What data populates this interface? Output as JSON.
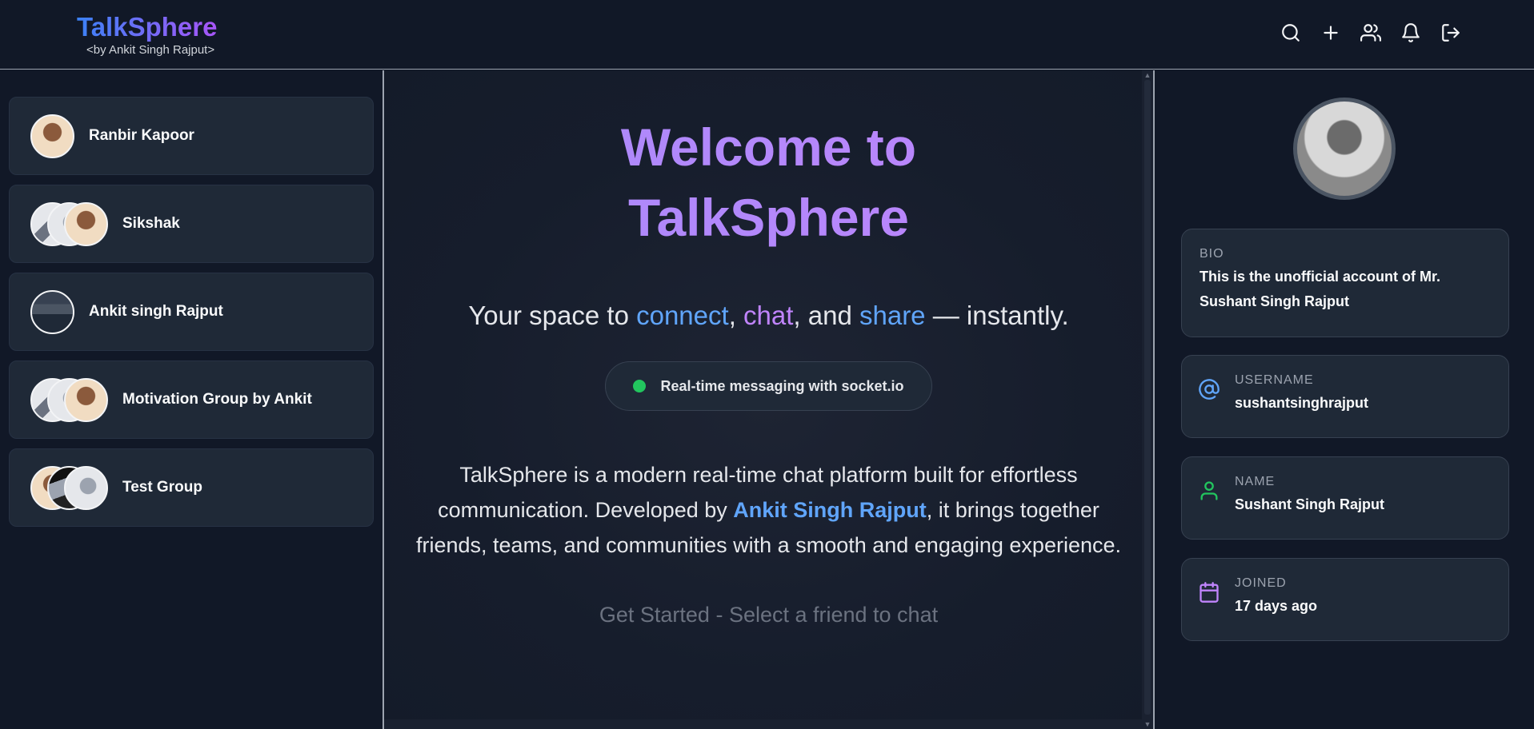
{
  "header": {
    "brand_title": "TalkSphere",
    "brand_subtitle": "<by Ankit Singh Rajput>",
    "icons": [
      "search-icon",
      "plus-icon",
      "users-icon",
      "bell-icon",
      "logout-icon"
    ]
  },
  "chats": [
    {
      "name": "Ranbir Kapoor"
    },
    {
      "name": "Sikshak"
    },
    {
      "name": "Ankit singh Rajput"
    },
    {
      "name": "Motivation Group by Ankit"
    },
    {
      "name": "Test Group"
    }
  ],
  "main": {
    "welcome_line1": "Welcome to",
    "welcome_line2": "TalkSphere",
    "tagline_prefix": "Your space to ",
    "tagline_connect": "connect",
    "tagline_sep1": ", ",
    "tagline_chat": "chat",
    "tagline_sep2": ", and ",
    "tagline_share": "share",
    "tagline_suffix": " — instantly.",
    "pill_text": "Real-time messaging with socket.io",
    "about_prefix": "TalkSphere is a modern real-time chat platform built for effortless communication. Developed by ",
    "about_author": "Ankit Singh Rajput",
    "about_suffix": ", it brings together friends, teams, and communities with a smooth and engaging experience.",
    "get_started": "Get Started - Select a friend to chat"
  },
  "profile": {
    "bio_label": "BIO",
    "bio_value": "This is the unofficial account of Mr. Sushant Singh Rajput",
    "username_label": "USERNAME",
    "username_value": "sushantsinghrajput",
    "name_label": "NAME",
    "name_value": "Sushant Singh Rajput",
    "joined_label": "JOINED",
    "joined_value": "17 days ago"
  },
  "colors": {
    "accent_blue": "#60a5fa",
    "accent_purple": "#c084fc",
    "online_green": "#22c55e"
  }
}
